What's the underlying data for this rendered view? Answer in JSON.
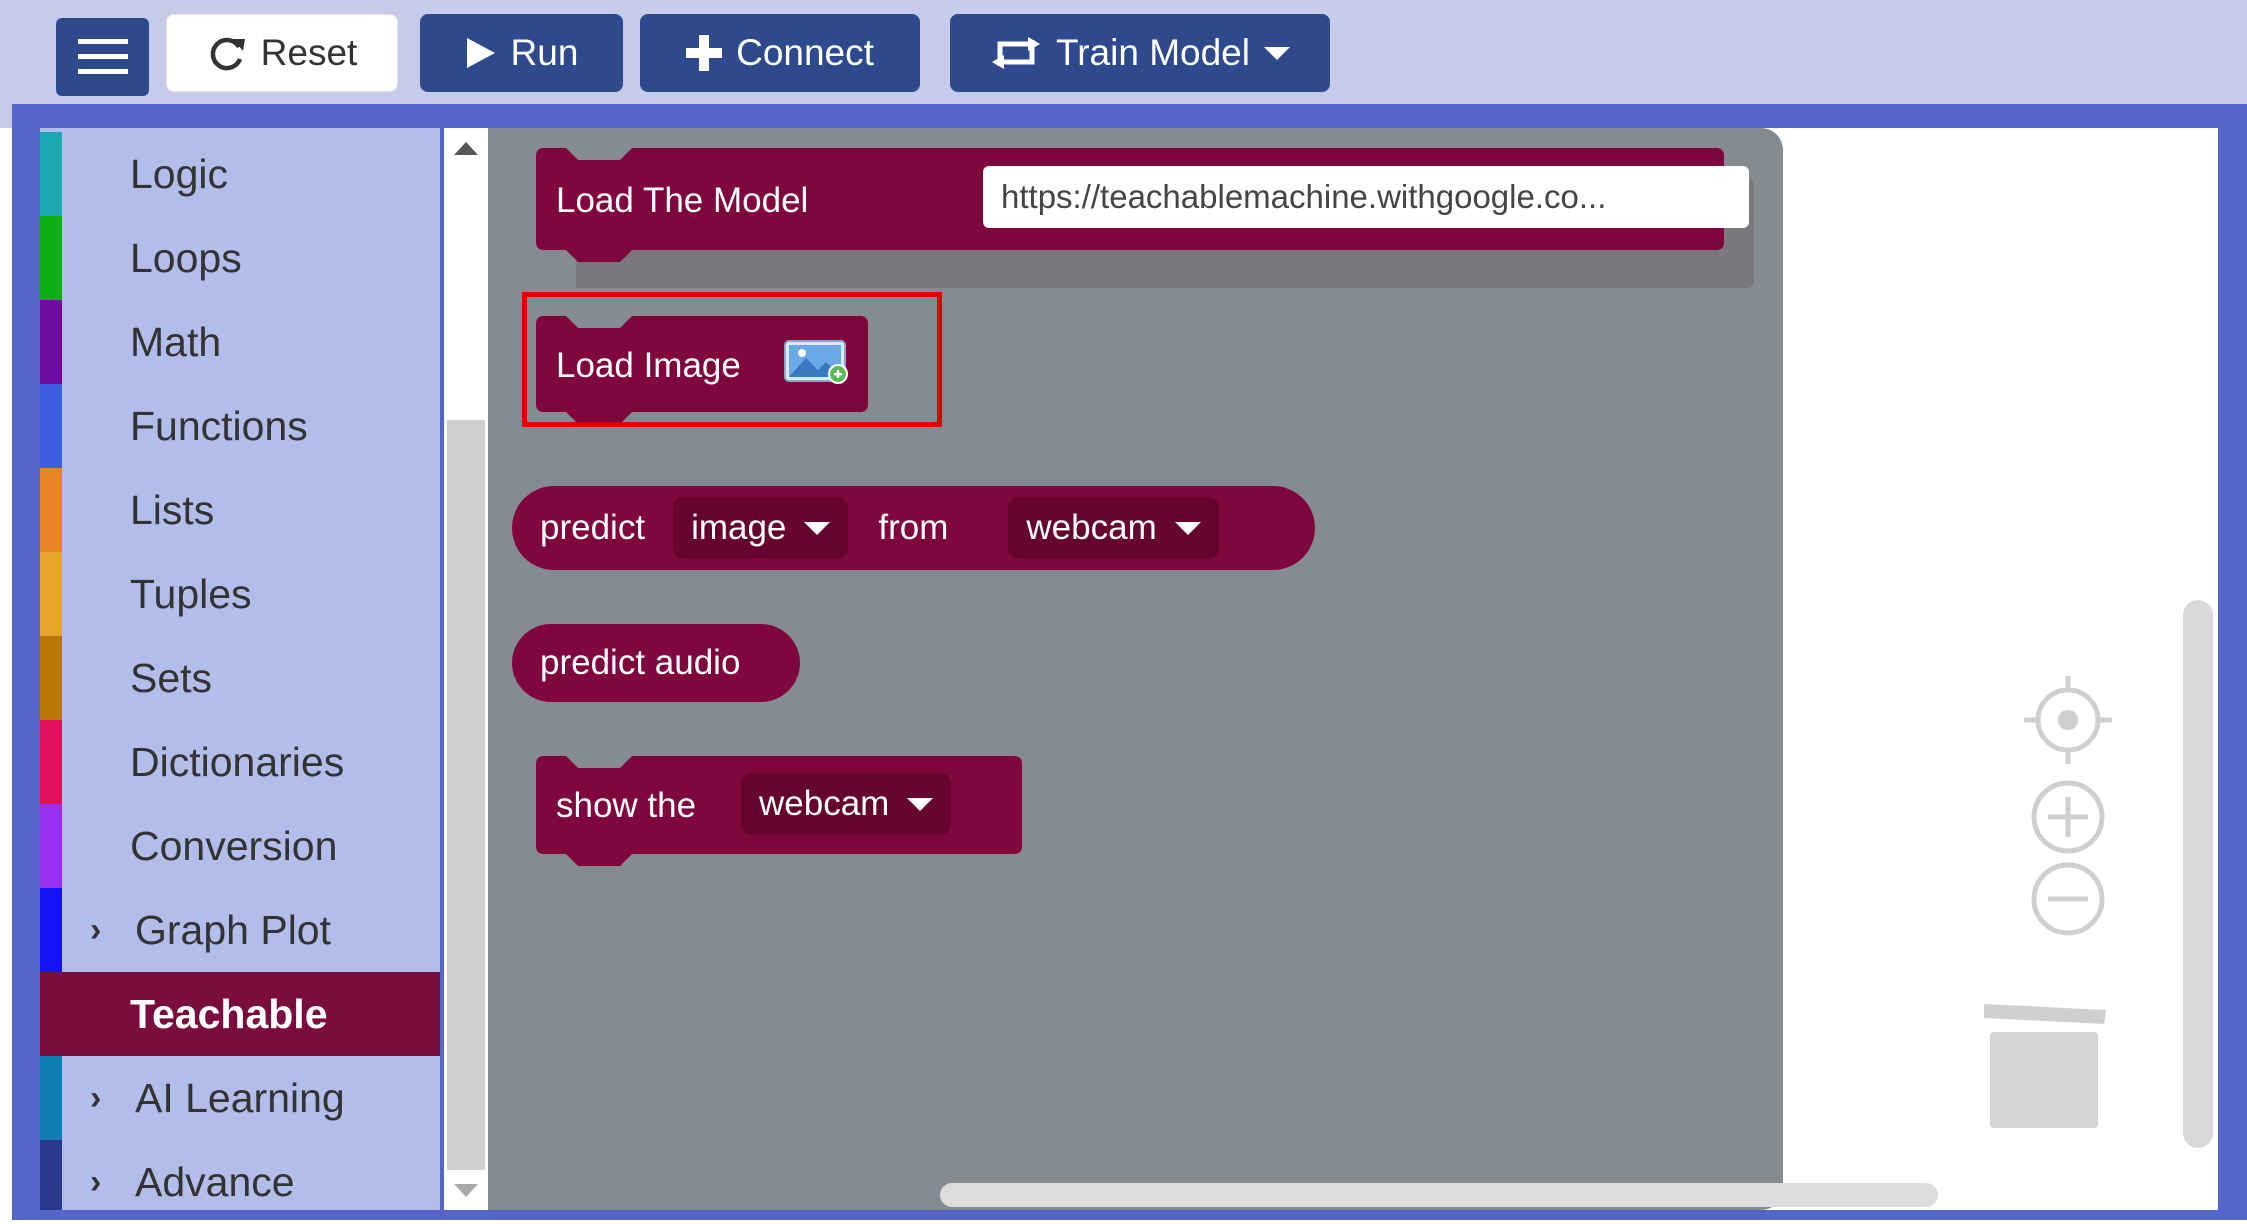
{
  "toolbar": {
    "menu_icon": "hamburger-icon",
    "reset_label": "Reset",
    "reset_icon": "refresh-icon",
    "run_label": "Run",
    "run_icon": "play-icon",
    "connect_label": "Connect",
    "connect_icon": "plus-icon",
    "train_label": "Train Model",
    "train_icon": "retrain-icon"
  },
  "categories": [
    {
      "label": "Logic",
      "color": "#1aa9b0"
    },
    {
      "label": "Loops",
      "color": "#0fae14"
    },
    {
      "label": "Math",
      "color": "#6f0aa3"
    },
    {
      "label": "Functions",
      "color": "#3d5fdf"
    },
    {
      "label": "Lists",
      "color": "#e8832a"
    },
    {
      "label": "Tuples",
      "color": "#e5a52a"
    },
    {
      "label": "Sets",
      "color": "#b97708"
    },
    {
      "label": "Dictionaries",
      "color": "#e2115c"
    },
    {
      "label": "Conversion",
      "color": "#9b30f0"
    },
    {
      "label": "Graph Plot",
      "color": "#1313f5",
      "expandable": true
    },
    {
      "label": "Teachable",
      "color": "#7a0c3e",
      "selected": true
    },
    {
      "label": "AI Learning",
      "color": "#0f7fb3",
      "expandable": true
    },
    {
      "label": "Advance",
      "color": "#2b3a8c",
      "expandable": true
    }
  ],
  "blocks": {
    "load_model_label": "Load The Model",
    "load_model_url": "https://teachablemachine.withgoogle.co...",
    "load_image_label": "Load Image",
    "predict_label": "predict",
    "predict_type_value": "image",
    "predict_from_label": "from",
    "predict_source_value": "webcam",
    "predict_audio_label": "predict audio",
    "show_label": "show the",
    "show_source_value": "webcam"
  },
  "colors": {
    "block": "#80063e",
    "toolbar_button": "#2e4a8c",
    "flyout_bg": "#858c91",
    "highlight": "#e10000"
  }
}
